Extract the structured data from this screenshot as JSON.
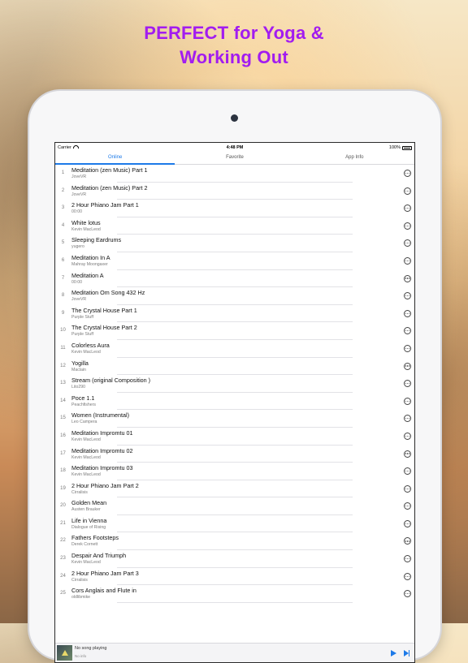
{
  "headline": {
    "line1": "PERFECT for Yoga &",
    "line2": "Working Out"
  },
  "status": {
    "carrier": "Carrier",
    "time": "4:48 PM",
    "battery": "100%"
  },
  "tabs": [
    {
      "label": "Online",
      "active": true
    },
    {
      "label": "Favorite",
      "active": false
    },
    {
      "label": "App Info",
      "active": false
    }
  ],
  "songs": [
    {
      "num": "1",
      "title": "Meditation (zen Music) Part 1",
      "artist": "JoveVR"
    },
    {
      "num": "2",
      "title": "Meditation (zen Music) Part 2",
      "artist": "JoveVR"
    },
    {
      "num": "3",
      "title": "2 Hour Phiano Jam Part 1",
      "artist": "00:00"
    },
    {
      "num": "4",
      "title": "White lotus",
      "artist": "Kevin MacLeod"
    },
    {
      "num": "5",
      "title": "Sleeping Eardrums",
      "artist": "yugero"
    },
    {
      "num": "6",
      "title": "Meditation In A",
      "artist": "Mahray Moongaxer"
    },
    {
      "num": "7",
      "title": "Meditation A",
      "artist": "00:00"
    },
    {
      "num": "8",
      "title": "Meditation Om Song 432 Hz",
      "artist": "JoveVR"
    },
    {
      "num": "9",
      "title": "The Crystal House Part 1",
      "artist": "Purple Stuff"
    },
    {
      "num": "10",
      "title": "The Crystal House Part 2",
      "artist": "Purple Stuff"
    },
    {
      "num": "11",
      "title": "Colorless Aura",
      "artist": "Kevin MacLeod"
    },
    {
      "num": "12",
      "title": "Yogilla",
      "artist": "Maclain"
    },
    {
      "num": "13",
      "title": "Stream (original Composition )",
      "artist": "Lito290"
    },
    {
      "num": "14",
      "title": "Poce 1.1",
      "artist": "Peachfishers"
    },
    {
      "num": "15",
      "title": "Women (Instrumental)",
      "artist": "Leo Campera"
    },
    {
      "num": "16",
      "title": "Meditation Impromtu 01",
      "artist": "Kevin MacLeod"
    },
    {
      "num": "17",
      "title": "Meditation Impromtu 02",
      "artist": "Kevin MacLeod"
    },
    {
      "num": "18",
      "title": "Meditation Impromtu 03",
      "artist": "Kevin MacLeod"
    },
    {
      "num": "19",
      "title": "2 Hour Phiano Jam Part 2",
      "artist": "Cirralisis"
    },
    {
      "num": "20",
      "title": "Golden Mean",
      "artist": "Austen Brauker"
    },
    {
      "num": "21",
      "title": "Life in Vienna",
      "artist": "Dialogue of Rising"
    },
    {
      "num": "22",
      "title": "Fathers Footsteps",
      "artist": "Derek Cornett"
    },
    {
      "num": "23",
      "title": "Despair And Triumph",
      "artist": "Kevin MacLeod"
    },
    {
      "num": "24",
      "title": "2 Hour Phiano Jam Part 3",
      "artist": "Cirralisis"
    },
    {
      "num": "25",
      "title": "Cors Anglais and Flute in",
      "artist": "oldlibmike"
    }
  ],
  "player": {
    "title": "No song playing",
    "subtitle": "No info"
  },
  "colors": {
    "accent": "#1d7ae8",
    "headline": "#a21cf0"
  }
}
